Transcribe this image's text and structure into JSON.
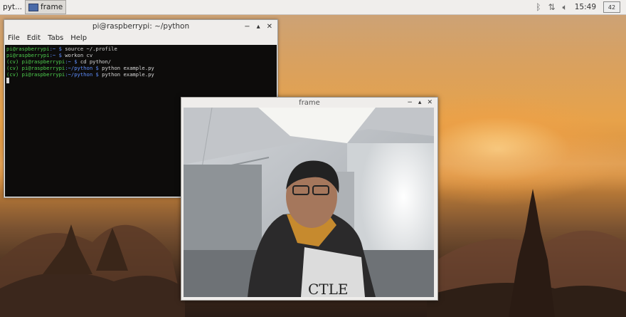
{
  "taskbar": {
    "tasks": [
      {
        "label": "pyt..."
      },
      {
        "label": "frame"
      }
    ],
    "tray": {
      "bluetooth_icon": "bluetooth-icon",
      "network_icon": "network-updown-icon",
      "volume_icon": "volume-icon",
      "clock": "15:49",
      "cpu": "42"
    }
  },
  "terminal": {
    "title": "pi@raspberrypi: ~/python",
    "menu": [
      "File",
      "Edit",
      "Tabs",
      "Help"
    ],
    "lines": [
      {
        "prompt": "pi@raspberrypi",
        "path": ":~ $",
        "cmd": " source ~/.profile"
      },
      {
        "prompt": "pi@raspberrypi",
        "path": ":~ $",
        "cmd": " workon cv"
      },
      {
        "prompt": "(cv) pi@raspberrypi",
        "path": ":~ $",
        "cmd": " cd python/"
      },
      {
        "prompt": "(cv) pi@raspberrypi",
        "path": ":~/python $",
        "cmd": " python example.py"
      },
      {
        "prompt": "(cv) pi@raspberrypi",
        "path": ":~/python $",
        "cmd": " python example.py"
      }
    ]
  },
  "frame": {
    "title": "frame",
    "shirt_text": "CTLE"
  },
  "colors": {
    "taskbar_bg": "#f0eeec",
    "terminal_bg": "#0d0c0b",
    "prompt_green": "#4fd04f",
    "path_blue": "#5f8fff"
  }
}
